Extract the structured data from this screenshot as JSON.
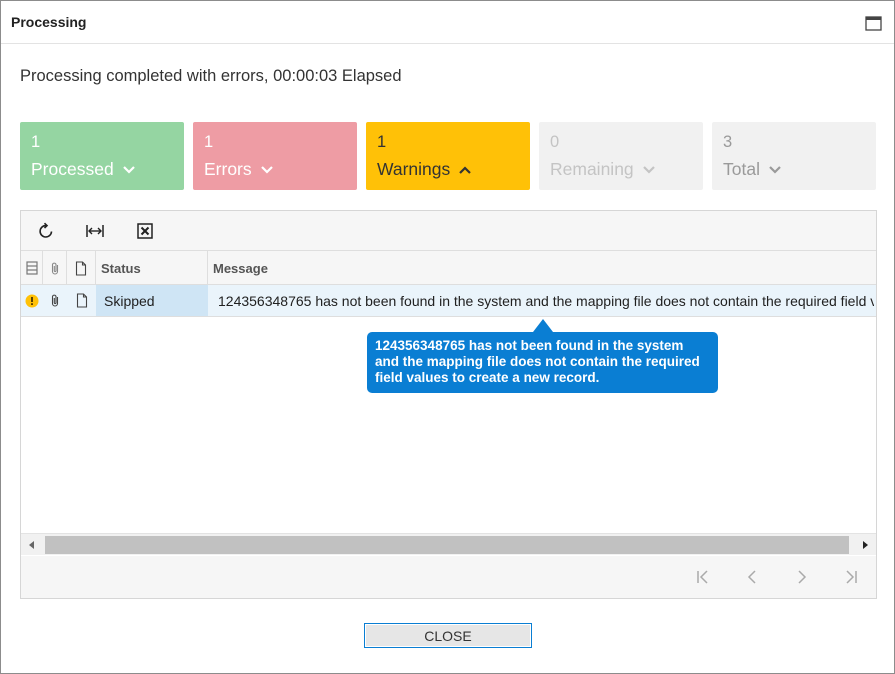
{
  "dialog": {
    "title": "Processing",
    "summary": "Processing completed with errors, 00:00:03 Elapsed"
  },
  "tiles": [
    {
      "count": "1",
      "label": "Processed",
      "chevron": "down",
      "color": "#95d5a2"
    },
    {
      "count": "1",
      "label": "Errors",
      "chevron": "down",
      "color": "#ee9ca4"
    },
    {
      "count": "1",
      "label": "Warnings",
      "chevron": "up",
      "color": "#ffc107"
    },
    {
      "count": "0",
      "label": "Remaining",
      "chevron": "down",
      "color": "#f1f1f1"
    },
    {
      "count": "3",
      "label": "Total",
      "chevron": "down",
      "color": "#f1f1f1"
    }
  ],
  "toolbar": {
    "icons": [
      "refresh-icon",
      "fit-columns-icon",
      "export-excel-icon"
    ]
  },
  "table": {
    "columns": [
      "Status",
      "Message"
    ],
    "header_icons": [
      "row-selector-icon",
      "attachment-icon",
      "file-icon"
    ],
    "rows": [
      {
        "warning_icon": "warning-icon",
        "status": "Skipped",
        "message": "124356348765 has not been found in the system and the mapping file does not contain the required field values to create a new record."
      }
    ]
  },
  "tooltip": {
    "text": "124356348765 has not been found in the system and the mapping file does not contain the required field values to create a new record."
  },
  "pager": {
    "icons": [
      "first-page-icon",
      "previous-page-icon",
      "next-page-icon",
      "last-page-icon"
    ]
  },
  "footer": {
    "close_label": "CLOSE"
  },
  "colors": {
    "accent": "#0a7ed3",
    "warning": "#ffc107"
  }
}
